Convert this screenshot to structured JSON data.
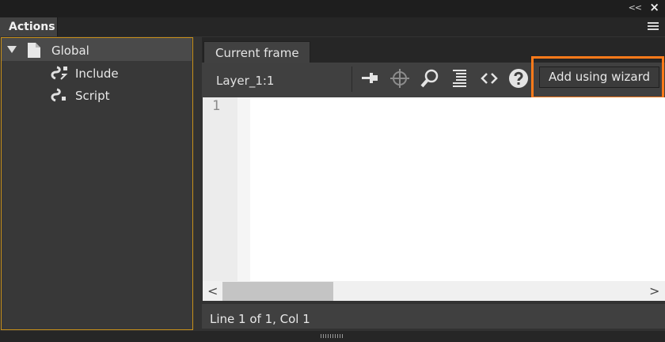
{
  "window": {
    "collapse_glyph": "<<",
    "close_glyph": "×"
  },
  "panel": {
    "title": "Actions"
  },
  "tree": {
    "root_label": "Global",
    "items": [
      {
        "label": "Include",
        "icon": "script-icon"
      },
      {
        "label": "Script",
        "icon": "script-icon"
      }
    ]
  },
  "editor_panel": {
    "tab_label": "Current frame",
    "layer_label": "Layer_1:1",
    "toolbar_icons": [
      "pin-icon",
      "target-icon",
      "find-icon",
      "format-icon",
      "code-hint-icon",
      "help-icon"
    ],
    "wizard_button_label": "Add using wizard",
    "highlight_color": "#ff7a1a",
    "line_number": "1"
  },
  "scrollbar": {
    "left_arrow": "<",
    "right_arrow": ">"
  },
  "status": {
    "text": "Line 1 of 1, Col 1"
  }
}
